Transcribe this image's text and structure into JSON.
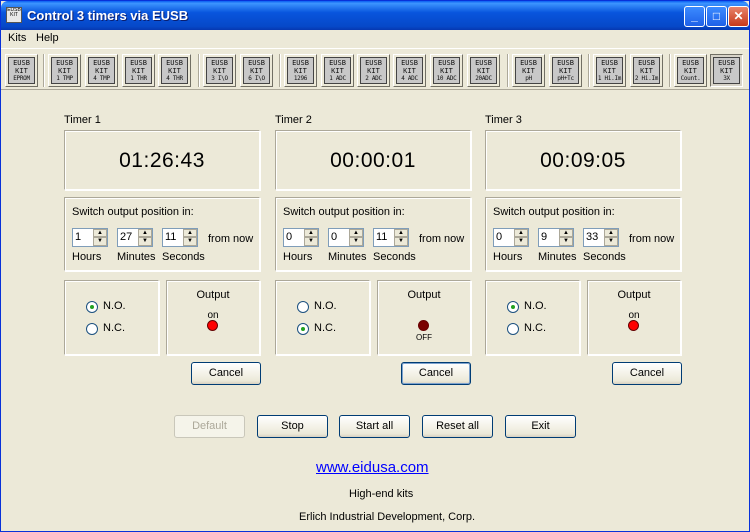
{
  "window": {
    "title": "Control 3 timers via EUSB",
    "icon_text": "EUSB KIT"
  },
  "menu": [
    "Kits",
    "Help"
  ],
  "toolbar": [
    {
      "top": "EUSB",
      "mid": "KIT",
      "sub": "EPROM",
      "sub_top": "E"
    },
    {
      "top": "EUSB",
      "mid": "KIT",
      "sub": "1 TMP"
    },
    {
      "top": "EUSB",
      "mid": "KIT",
      "sub": "4 TMP"
    },
    {
      "top": "EUSB",
      "mid": "KIT",
      "sub": "1 THR"
    },
    {
      "top": "EUSB",
      "mid": "KIT",
      "sub": "4 THR"
    },
    {
      "top": "EUSB",
      "mid": "KIT",
      "sub": "3 I\\O"
    },
    {
      "top": "EUSB",
      "mid": "KIT",
      "sub": "6 I\\O"
    },
    {
      "top": "EUSB",
      "mid": "KIT",
      "sub": "1296",
      "sub_top": "MAX"
    },
    {
      "top": "EUSB",
      "mid": "KIT",
      "sub": "1 ADC"
    },
    {
      "top": "EUSB",
      "mid": "KIT",
      "sub": "2 ADC"
    },
    {
      "top": "EUSB",
      "mid": "KIT",
      "sub": "4 ADC"
    },
    {
      "top": "EUSB",
      "mid": "KIT",
      "sub": "10 ADC"
    },
    {
      "top": "EUSB",
      "mid": "KIT",
      "sub": "20ADC"
    },
    {
      "top": "EUSB",
      "mid": "KIT",
      "sub": "pH"
    },
    {
      "top": "EUSB",
      "mid": "KIT",
      "sub": "pH+Tc"
    },
    {
      "top": "EUSB",
      "mid": "KIT",
      "sub": "1 Hi.Im"
    },
    {
      "top": "EUSB",
      "mid": "KIT",
      "sub": "2 Hi.Im"
    },
    {
      "top": "EUSB",
      "mid": "KIT",
      "sub": "Count."
    },
    {
      "top": "EUSB",
      "mid": "KIT",
      "sub": "3X"
    }
  ],
  "timers": [
    {
      "label": "Timer 1",
      "display": "01:26:43",
      "switch_label": "Switch output position in:",
      "hours": "1",
      "minutes": "27",
      "seconds": "11",
      "from_now": "from now",
      "hours_label": "Hours",
      "minutes_label": "Minutes",
      "seconds_label": "Seconds",
      "no_label": "N.O.",
      "nc_label": "N.C.",
      "mode": "N.O.",
      "output_label": "Output",
      "state_label": "on",
      "led_color": "#ff0000",
      "cancel_label": "Cancel"
    },
    {
      "label": "Timer 2",
      "display": "00:00:01",
      "switch_label": "Switch output position in:",
      "hours": "0",
      "minutes": "0",
      "seconds": "11",
      "from_now": "from now",
      "hours_label": "Hours",
      "minutes_label": "Minutes",
      "seconds_label": "Seconds",
      "no_label": "N.O.",
      "nc_label": "N.C.",
      "mode": "N.C.",
      "output_label": "Output",
      "state_label": "OFF",
      "led_color": "#7a0000",
      "cancel_label": "Cancel"
    },
    {
      "label": "Timer 3",
      "display": "00:09:05",
      "switch_label": "Switch output position in:",
      "hours": "0",
      "minutes": "9",
      "seconds": "33",
      "from_now": "from now",
      "hours_label": "Hours",
      "minutes_label": "Minutes",
      "seconds_label": "Seconds",
      "no_label": "N.O.",
      "nc_label": "N.C.",
      "mode": "N.O.",
      "output_label": "Output",
      "state_label": "on",
      "led_color": "#ff0000",
      "cancel_label": "Cancel"
    }
  ],
  "buttons": {
    "default": "Default",
    "stop": "Stop",
    "start_all": "Start all",
    "reset_all": "Reset all",
    "exit": "Exit"
  },
  "footer": {
    "link": "www.eidusa.com",
    "tagline": "High-end kits",
    "company": "Erlich Industrial Development, Corp."
  }
}
